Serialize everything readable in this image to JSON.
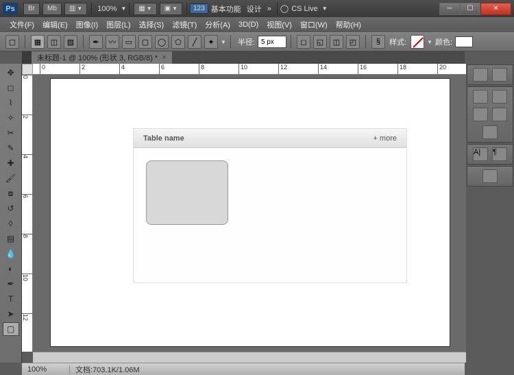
{
  "titlebar": {
    "ps": "Ps",
    "br": "Br",
    "mb": "Mb",
    "zoom_label": "100%",
    "badge": "123",
    "essentials": "基本功能",
    "design": "设计",
    "more": "»",
    "cslive": "CS Live"
  },
  "menu": {
    "file": "文件(F)",
    "edit": "编辑(E)",
    "image": "图像(I)",
    "layer": "图层(L)",
    "select": "选择(S)",
    "filter": "滤镜(T)",
    "analysis": "分析(A)",
    "d3d": "3D(D)",
    "view": "视图(V)",
    "window": "窗口(W)",
    "help": "帮助(H)"
  },
  "options": {
    "radius_label": "半径:",
    "radius_value": "5 px",
    "style_label": "样式:",
    "color_label": "颜色:"
  },
  "tab": {
    "title": "未标题-1 @ 100% (形状 3, RGB/8) *"
  },
  "ruler": {
    "h": [
      "0",
      "2",
      "4",
      "6",
      "8",
      "10",
      "12",
      "14",
      "16",
      "18",
      "20"
    ],
    "v": [
      "0",
      "2",
      "4",
      "6",
      "8",
      "10",
      "12"
    ]
  },
  "canvas": {
    "table_name": "Table name",
    "more": "+ more"
  },
  "status": {
    "zoom": "100%",
    "doc_label": "文档:",
    "doc_size": "703.1K/1.06M"
  }
}
